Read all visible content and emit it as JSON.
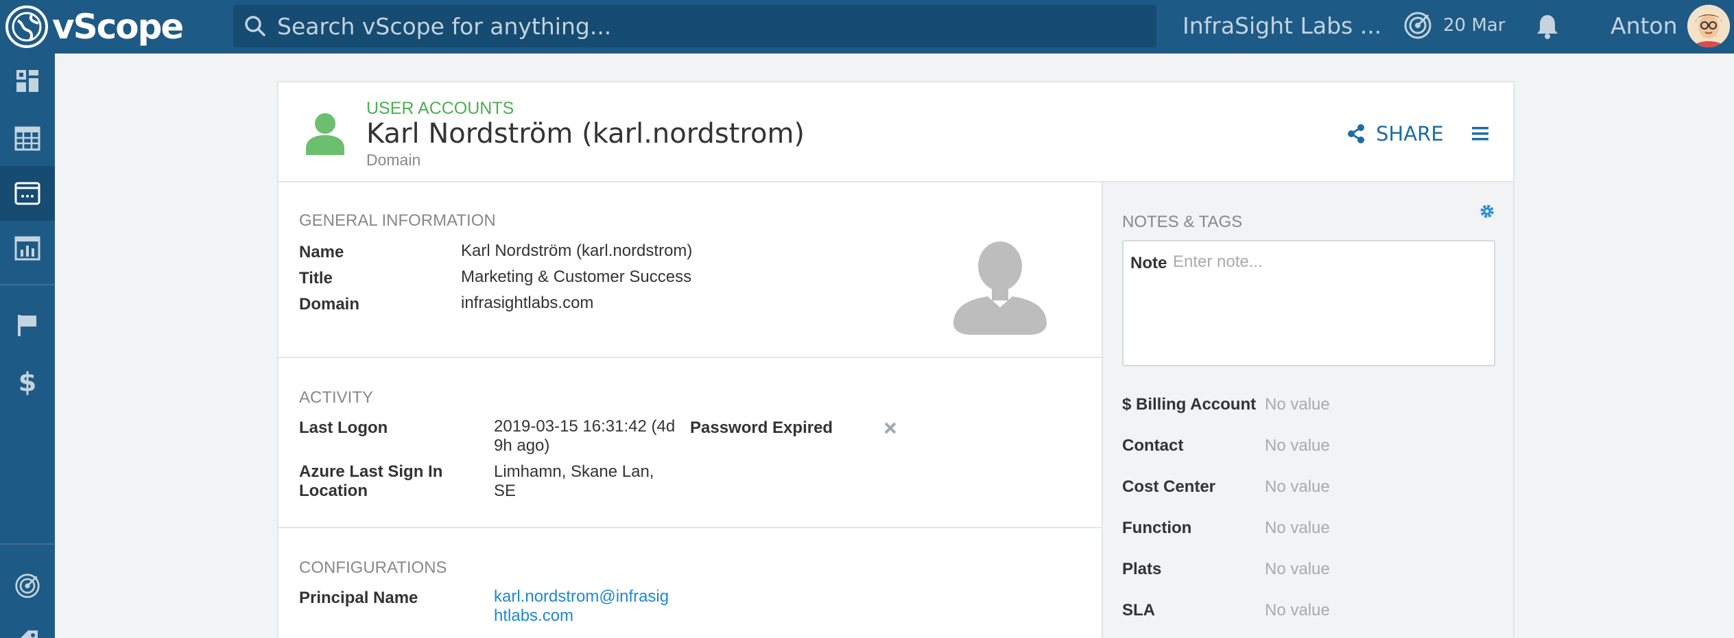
{
  "app": {
    "logo_text": "vScope",
    "search_placeholder": "Search vScope for anything...",
    "org_name": "InfraSight Labs ...",
    "date": "20 Mar",
    "user_name": "Anton"
  },
  "header": {
    "category": "USER ACCOUNTS",
    "title": "Karl Nordström (karl.nordstrom)",
    "subtitle": "Domain",
    "share_label": "SHARE"
  },
  "general": {
    "section_title": "GENERAL INFORMATION",
    "name_label": "Name",
    "name_value": "Karl Nordström (karl.nordstrom)",
    "title_label": "Title",
    "title_value": "Marketing & Customer Success",
    "domain_label": "Domain",
    "domain_value": "infrasightlabs.com"
  },
  "activity": {
    "section_title": "ACTIVITY",
    "last_logon_label": "Last Logon",
    "last_logon_value_1": "2019-03-15 16:31:42 (4d",
    "last_logon_value_2": "9h ago)",
    "password_expired_label": "Password Expired",
    "azure_label_1": "Azure Last Sign In",
    "azure_label_2": "Location",
    "azure_value_1": "Limhamn, Skane Lan,",
    "azure_value_2": "SE"
  },
  "configurations": {
    "section_title": "CONFIGURATIONS",
    "principal_label": "Principal Name",
    "principal_value_1": "karl.nordstrom@infrasig",
    "principal_value_2": "htlabs.com"
  },
  "notes": {
    "section_title": "NOTES & TAGS",
    "note_label": "Note",
    "note_placeholder": "Enter note...",
    "properties": [
      {
        "label": "$ Billing Account",
        "value": "No value"
      },
      {
        "label": "Contact",
        "value": "No value"
      },
      {
        "label": "Cost Center",
        "value": "No value"
      },
      {
        "label": "Function",
        "value": "No value"
      },
      {
        "label": "Plats",
        "value": "No value"
      },
      {
        "label": "SLA",
        "value": "No value"
      }
    ]
  },
  "icons": {
    "header_user": "user-icon",
    "share": "share-icon",
    "menu": "hamburger-menu-icon",
    "settings": "gear-icon",
    "password_status": "x-mark-icon"
  },
  "colors": {
    "primary": "#1e5a86",
    "accent_green": "#4caf50",
    "link": "#1e88d0"
  }
}
